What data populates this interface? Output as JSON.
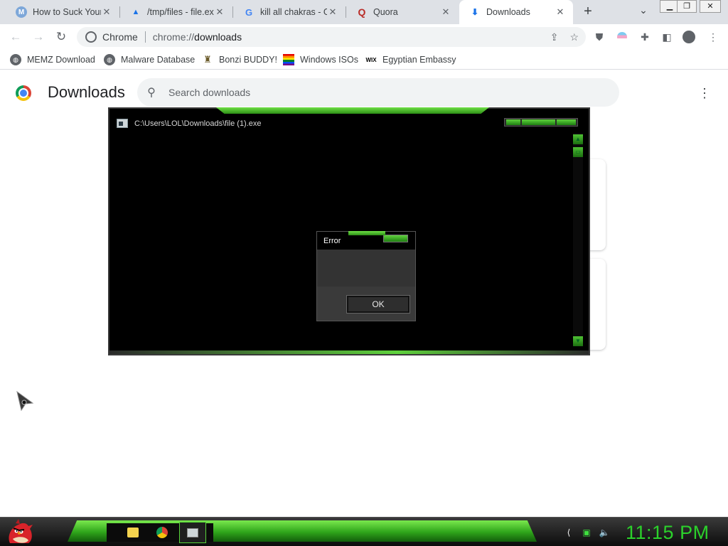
{
  "tabs": [
    {
      "title": "How to Suck Your",
      "icon": "m-icon",
      "icon_char": "M"
    },
    {
      "title": "/tmp/files - file.ex",
      "icon": "cloud-upload-icon",
      "icon_char": "▲"
    },
    {
      "title": "kill all chakras - G",
      "icon": "google-icon",
      "icon_char": "G"
    },
    {
      "title": "Quora",
      "icon": "quora-icon",
      "icon_char": "Q"
    },
    {
      "title": "Downloads",
      "icon": "download-icon",
      "icon_char": "⬇"
    }
  ],
  "omnibox": {
    "scheme_label": "Chrome",
    "url_prefix": "chrome://",
    "url_host": "downloads"
  },
  "bookmarks": [
    {
      "label": "MEMZ Download",
      "icon": "globe-icon"
    },
    {
      "label": "Malware Database",
      "icon": "globe-icon"
    },
    {
      "label": "Bonzi BUDDY!",
      "icon": "bonzi-icon"
    },
    {
      "label": "Windows ISOs",
      "icon": "rainbow-flag-icon"
    },
    {
      "label": "Egyptian Embassy",
      "icon": "wix-icon",
      "icon_text": "WIX"
    }
  ],
  "downloads": {
    "title": "Downloads",
    "search_placeholder": "Search downloads"
  },
  "console": {
    "title": "C:\\Users\\LOL\\Downloads\\file (1).exe"
  },
  "error_dialog": {
    "title": "Error",
    "message": "",
    "ok_label": "OK"
  },
  "taskbar": {
    "clock": "11:15 PM",
    "accent_color": "#2bd12b"
  }
}
